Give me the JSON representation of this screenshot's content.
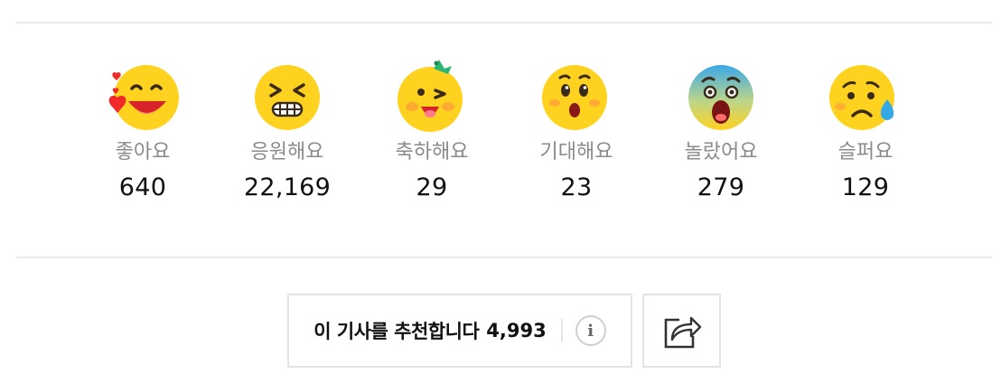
{
  "reactions": [
    {
      "icon": "heart-eyes-emoji-icon",
      "label": "좋아요",
      "count": "640"
    },
    {
      "icon": "cheering-emoji-icon",
      "label": "응원해요",
      "count": "22,169"
    },
    {
      "icon": "party-emoji-icon",
      "label": "축하해요",
      "count": "29"
    },
    {
      "icon": "hopeful-emoji-icon",
      "label": "기대해요",
      "count": "23"
    },
    {
      "icon": "shocked-emoji-icon",
      "label": "놀랐어요",
      "count": "279"
    },
    {
      "icon": "sad-emoji-icon",
      "label": "슬퍼요",
      "count": "129"
    }
  ],
  "recommend": {
    "label": "이 기사를 추천합니다",
    "count": "4,993",
    "info_icon": "info-icon",
    "info_glyph": "i"
  },
  "share": {
    "icon": "share-icon"
  },
  "colors": {
    "emoji_face": "#ffd21f",
    "label_gray": "#8a8a8a",
    "border": "#e3e3e3",
    "heart": "#f22a2a",
    "tear": "#35a9e6",
    "party_hat": "#2bb673"
  }
}
